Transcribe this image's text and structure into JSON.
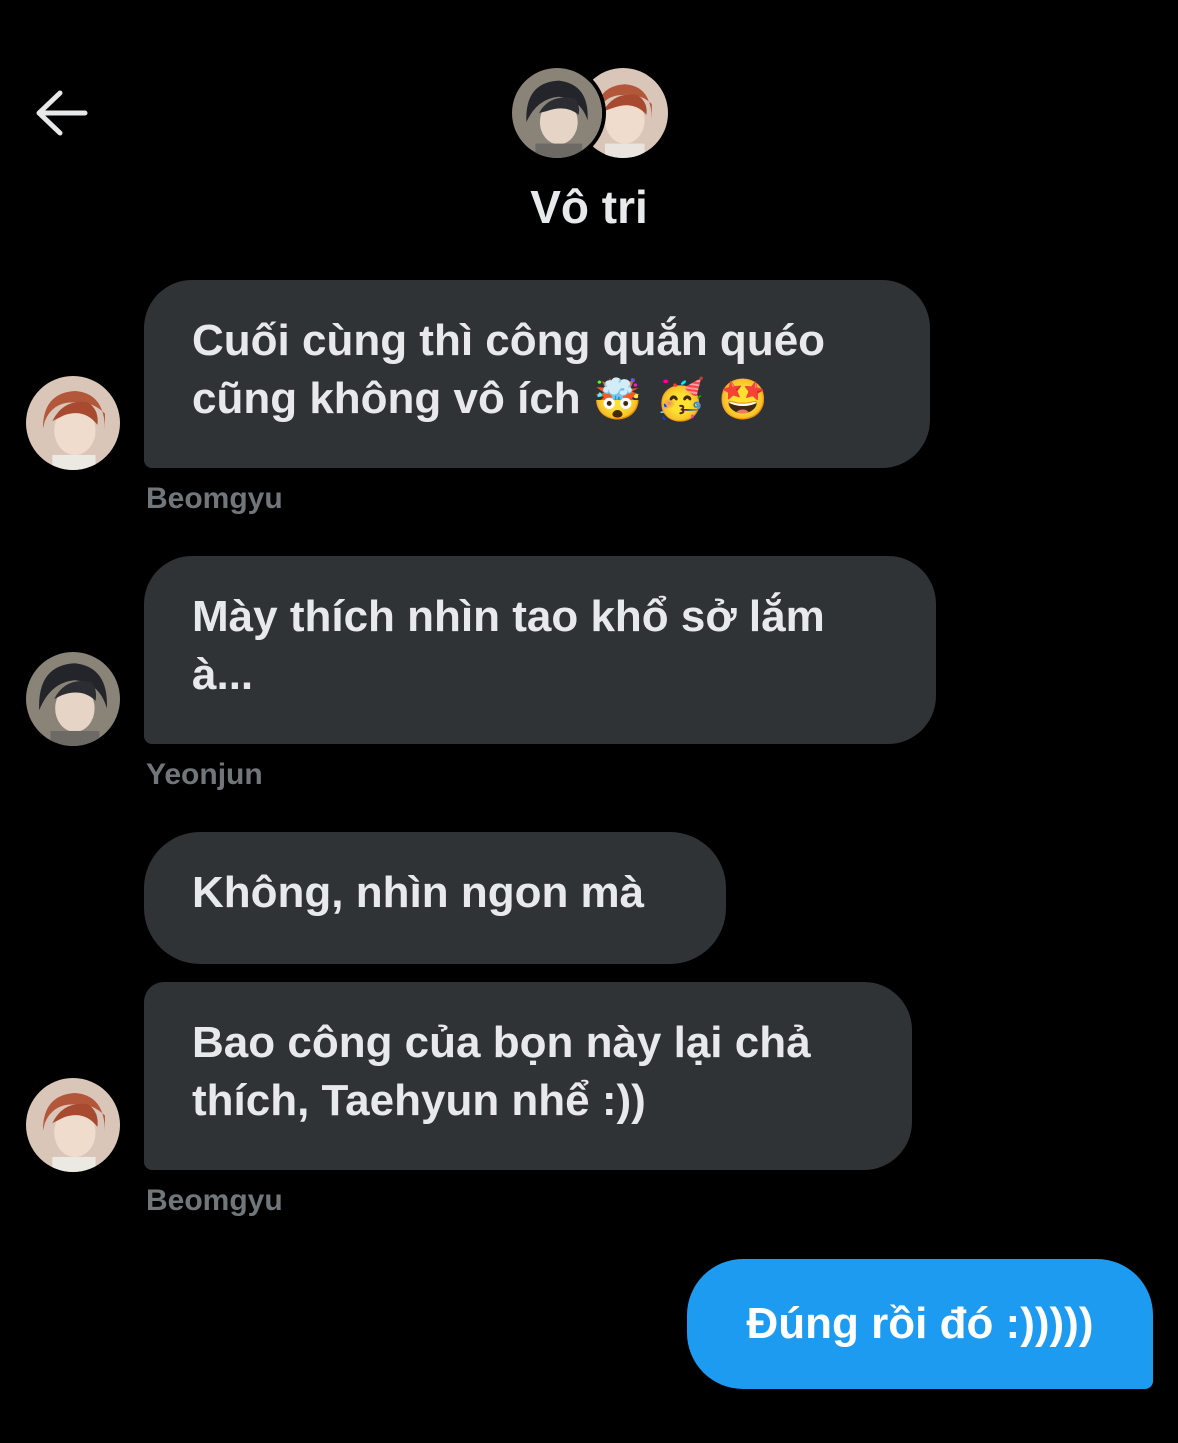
{
  "header": {
    "back_icon": "arrow-left-icon",
    "title": "Vô tri"
  },
  "messages": [
    {
      "sender": "Beomgyu",
      "text_line1": "Cuối cùng thì công quắn quéo",
      "text_line2": "cũng không vô ích",
      "emojis": "🤯 🥳 🤩"
    },
    {
      "sender": "Yeonjun",
      "text_line1": "Mày thích nhìn tao khổ sở lắm",
      "text_line2": "à..."
    },
    {
      "sender": "Beomgyu",
      "text_line1": "Không, nhìn ngon mà"
    },
    {
      "sender": "Beomgyu",
      "text_line1": "Bao công của bọn này lại chả",
      "text_line2": "thích, Taehyun nhể :))"
    }
  ],
  "outgoing": {
    "text": "Đúng rồi đó :)))))"
  },
  "colors": {
    "background": "#000000",
    "incoming_bubble": "#2f3336",
    "outgoing_bubble": "#1d9bf0",
    "text_primary": "#e7e9ea",
    "text_secondary": "#71767b"
  }
}
